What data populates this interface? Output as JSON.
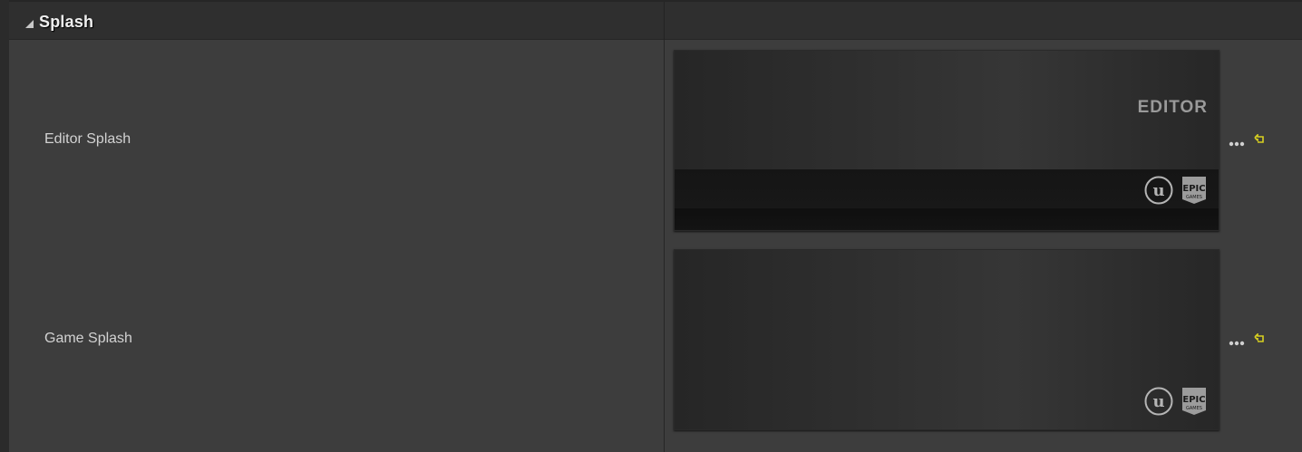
{
  "section": {
    "title": "Splash",
    "expanded": true
  },
  "properties": [
    {
      "label": "Editor Splash",
      "overlay_text": "EDITOR"
    },
    {
      "label": "Game Splash",
      "overlay_text": ""
    }
  ],
  "icons": {
    "expander": "collapse-triangle-icon",
    "browse": "ellipsis-icon",
    "reset": "reset-to-default-arrow-icon",
    "engine_logo": "unreal-engine-logo-icon",
    "publisher_logo": "epic-games-logo-icon"
  },
  "logos": {
    "engine_letter": "u",
    "publisher_top": "EPIC",
    "publisher_bottom": "GAMES"
  },
  "colors": {
    "background": "#3d3d3d",
    "header": "#2f2f2f",
    "label_text": "#d2d2d2",
    "reset_arrow": "#d8d020"
  }
}
